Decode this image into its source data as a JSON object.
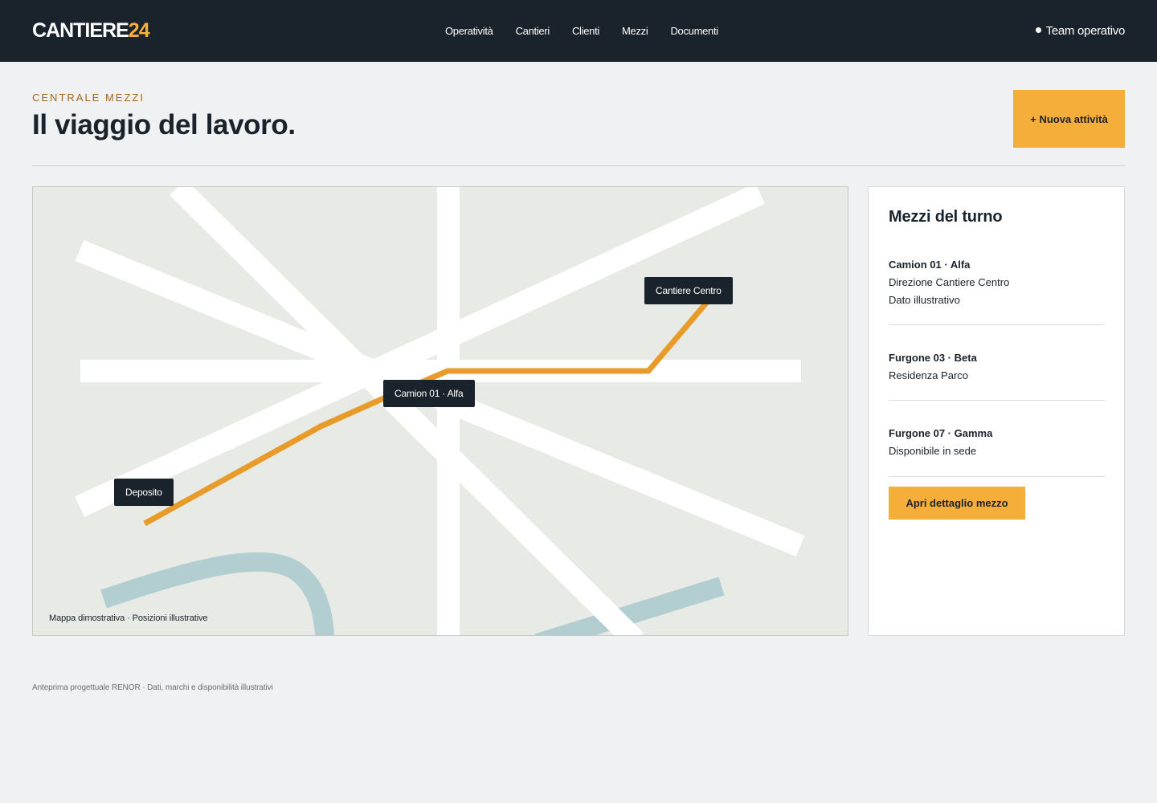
{
  "header": {
    "logo_main": "CANTIERE",
    "logo_accent": "24",
    "nav": [
      "Operatività",
      "Cantieri",
      "Clienti",
      "Mezzi",
      "Documenti"
    ],
    "team": "Team operativo"
  },
  "page": {
    "eyebrow": "CENTRALE MEZZI",
    "title": "Il viaggio del lavoro.",
    "new_button": "+ Nuova attività"
  },
  "map": {
    "labels": {
      "cantiere": "Cantiere Centro",
      "camion": "Camion 01 · Alfa",
      "deposito": "Deposito"
    },
    "caption": "Mappa dimostrativa · Posizioni illustrative",
    "colors": {
      "route": "#e89b28",
      "road": "#ffffff",
      "water": "#b3ced1",
      "land": "#e7eae5"
    }
  },
  "panel": {
    "title": "Mezzi del turno",
    "vehicles": [
      {
        "name": "Camion 01 · Alfa",
        "lines": [
          "Direzione Cantiere Centro",
          "Dato illustrativo"
        ]
      },
      {
        "name": "Furgone 03 · Beta",
        "lines": [
          "Residenza Parco"
        ]
      },
      {
        "name": "Furgone 07 · Gamma",
        "lines": [
          "Disponibile in sede"
        ]
      }
    ],
    "detail_button": "Apri dettaglio mezzo"
  },
  "footer": {
    "note": "Anteprima progettuale RENOR · Dati, marchi e disponibilità illustrativi"
  },
  "colors": {
    "accent": "#f6ae3b",
    "dark": "#1a222b",
    "eyebrow": "#a3651a",
    "background": "#f0f1f2"
  }
}
